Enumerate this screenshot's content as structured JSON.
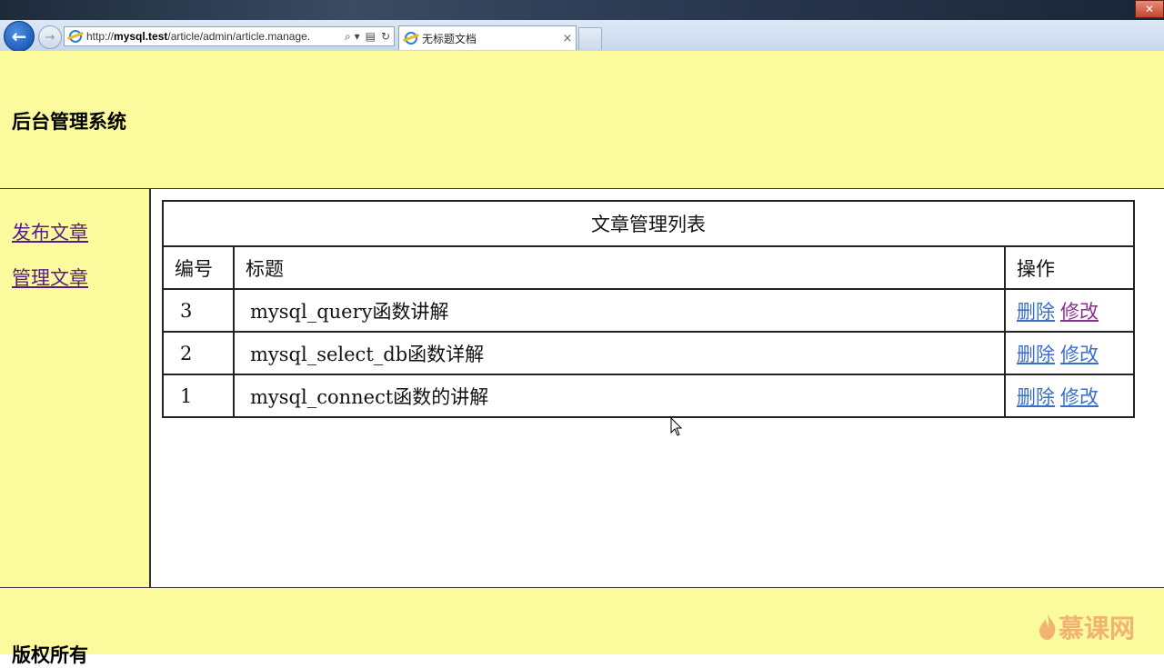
{
  "browser": {
    "url_prefix": "http://",
    "url_host": "mysql.test",
    "url_path": "/article/admin/article.manage.",
    "search_glyph": "⌕ ▾",
    "compat_glyph": "▤",
    "refresh_glyph": "↻",
    "tab_title": "无标题文档",
    "tab_close": "×",
    "back_glyph": "←",
    "forward_glyph": "→"
  },
  "header": {
    "site_title": "后台管理系统"
  },
  "sidebar": {
    "items": [
      {
        "label": "发布文章"
      },
      {
        "label": "管理文章"
      }
    ]
  },
  "table": {
    "caption": "文章管理列表",
    "columns": [
      "编号",
      "标题",
      "操作"
    ],
    "rows": [
      {
        "id": "3",
        "title": "mysql_query函数讲解",
        "delete_label": "删除",
        "edit_label": "修改"
      },
      {
        "id": "2",
        "title": "mysql_select_db函数详解",
        "delete_label": "删除",
        "edit_label": "修改"
      },
      {
        "id": "1",
        "title": "mysql_connect函数的讲解",
        "delete_label": "删除",
        "edit_label": "修改"
      }
    ]
  },
  "footer": {
    "copyright": "版权所有"
  },
  "watermark": {
    "text": "慕课网"
  },
  "colors": {
    "page_yellow": "#fbfa9c",
    "link_blue": "#3a6fc9",
    "link_visited": "#8a2f92"
  }
}
